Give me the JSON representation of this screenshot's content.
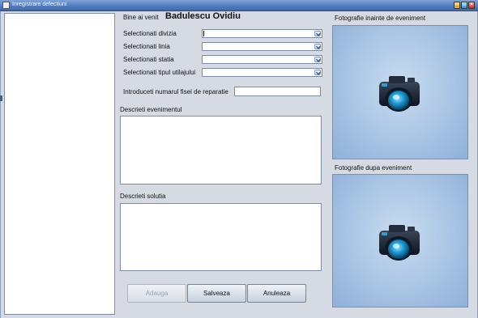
{
  "window": {
    "title": "Inregistrare defectiuni"
  },
  "header": {
    "welcome_label": "Bine ai venit",
    "user_name": "Badulescu Ovidiu"
  },
  "form": {
    "divizia_label": "Selectionati divizia",
    "linia_label": "Selectionati linia",
    "statia_label": "Selectionati statia",
    "utilaj_label": "Selectionati tipul utilajului",
    "fisa_label": "Introduceti numarul fisei de reparatie",
    "fisa_value": "",
    "eveniment_label": "Descrieti evenimentul",
    "eveniment_value": "",
    "solutia_label": "Descrieti solutia",
    "solutia_value": ""
  },
  "buttons": {
    "adauga": "Adauga",
    "salveaza": "Salveaza",
    "anuleaza": "Anuleaza"
  },
  "photos": {
    "before_label": "Fotografie inainte de eveniment",
    "after_label": "Fotografie dupa eveniment"
  },
  "icons": {
    "camera": "camera-icon",
    "dropdown": "chevron-down-icon"
  },
  "colors": {
    "accent": "#2a9fd8",
    "title_bar": "#4f7bbd",
    "photo_bg": "#a9c4e4"
  }
}
